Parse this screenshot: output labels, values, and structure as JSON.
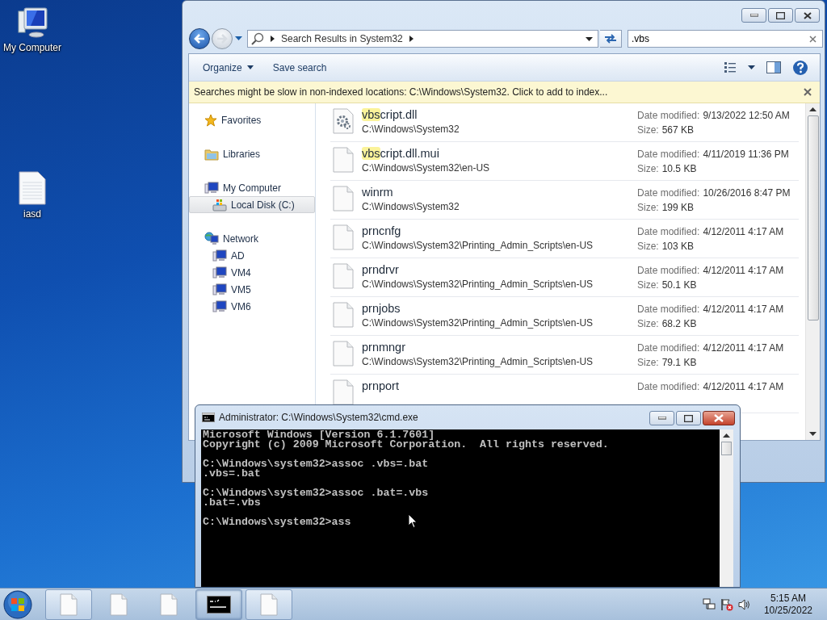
{
  "desktop_icons": [
    {
      "label": "My Computer",
      "kind": "computer"
    },
    {
      "label": "iasd",
      "kind": "text-file"
    }
  ],
  "explorer": {
    "address": {
      "crumb": "Search Results in System32"
    },
    "search": {
      "value": ".vbs"
    },
    "toolbar": {
      "organize": "Organize",
      "save_search": "Save search"
    },
    "info_bar": "Searches might be slow in non-indexed locations: C:\\Windows\\System32. Click to add to index...",
    "nav_pane": [
      {
        "label": "Favorites",
        "kind": "star",
        "selected": false
      },
      {
        "label": "Libraries",
        "kind": "library",
        "selected": false
      },
      {
        "label": "My Computer",
        "kind": "computer",
        "selected": false,
        "children": [
          {
            "label": "Local Disk (C:)",
            "kind": "drive",
            "selected": true
          }
        ]
      },
      {
        "label": "Network",
        "kind": "network",
        "selected": false,
        "children": [
          {
            "label": "AD",
            "kind": "computer",
            "selected": false
          },
          {
            "label": "VM4",
            "kind": "computer",
            "selected": false
          },
          {
            "label": "VM5",
            "kind": "computer",
            "selected": false
          },
          {
            "label": "VM6",
            "kind": "computer",
            "selected": false
          }
        ]
      }
    ],
    "files": [
      {
        "kind": "settings-file",
        "name_parts": [
          {
            "text": "vbs",
            "highlighted": true
          },
          {
            "text": "cript.dll",
            "highlighted": false
          }
        ],
        "path": "C:\\Windows\\System32",
        "date_label": "Date modified:",
        "date": "9/13/2022 12:50 AM",
        "size_label": "Size:",
        "size": "567 KB"
      },
      {
        "kind": "file",
        "name_parts": [
          {
            "text": "vbs",
            "highlighted": true
          },
          {
            "text": "cript.dll.mui",
            "highlighted": false
          }
        ],
        "path": "C:\\Windows\\System32\\en-US",
        "date_label": "Date modified:",
        "date": "4/11/2019 11:36 PM",
        "size_label": "Size:",
        "size": "10.5 KB"
      },
      {
        "kind": "file",
        "name_parts": [
          {
            "text": "winrm",
            "highlighted": false
          }
        ],
        "path": "C:\\Windows\\System32",
        "date_label": "Date modified:",
        "date": "10/26/2016 8:47 PM",
        "size_label": "Size:",
        "size": "199 KB"
      },
      {
        "kind": "file",
        "name_parts": [
          {
            "text": "prncnfg",
            "highlighted": false
          }
        ],
        "path": "C:\\Windows\\System32\\Printing_Admin_Scripts\\en-US",
        "date_label": "Date modified:",
        "date": "4/12/2011 4:17 AM",
        "size_label": "Size:",
        "size": "103 KB"
      },
      {
        "kind": "file",
        "name_parts": [
          {
            "text": "prndrvr",
            "highlighted": false
          }
        ],
        "path": "C:\\Windows\\System32\\Printing_Admin_Scripts\\en-US",
        "date_label": "Date modified:",
        "date": "4/12/2011 4:17 AM",
        "size_label": "Size:",
        "size": "50.1 KB"
      },
      {
        "kind": "file",
        "name_parts": [
          {
            "text": "prnjobs",
            "highlighted": false
          }
        ],
        "path": "C:\\Windows\\System32\\Printing_Admin_Scripts\\en-US",
        "date_label": "Date modified:",
        "date": "4/12/2011 4:17 AM",
        "size_label": "Size:",
        "size": "68.2 KB"
      },
      {
        "kind": "file",
        "name_parts": [
          {
            "text": "prnmngr",
            "highlighted": false
          }
        ],
        "path": "C:\\Windows\\System32\\Printing_Admin_Scripts\\en-US",
        "date_label": "Date modified:",
        "date": "4/12/2011 4:17 AM",
        "size_label": "Size:",
        "size": "79.1 KB"
      },
      {
        "kind": "file",
        "name_parts": [
          {
            "text": "prnport",
            "highlighted": false
          }
        ],
        "date_label": "Date modified:",
        "date": "4/12/2011 4:17 AM"
      }
    ]
  },
  "console": {
    "title": "Administrator: C:\\Windows\\System32\\cmd.exe",
    "blocks": [
      [
        "Microsoft Windows [Version 6.1.7601]",
        "Copyright (c) 2009 Microsoft Corporation.  All rights reserved."
      ],
      [
        "C:\\Windows\\system32>assoc .vbs=.bat",
        ".vbs=.bat"
      ],
      [
        "C:\\Windows\\system32>assoc .bat=.vbs",
        ".bat=.vbs"
      ],
      [
        "C:\\Windows\\system32>ass"
      ]
    ]
  },
  "taskbar": {
    "buttons": [
      {
        "kind": "document",
        "open": true,
        "selected": false
      },
      {
        "kind": "document",
        "open": false,
        "selected": false
      },
      {
        "kind": "document",
        "open": false,
        "selected": false
      },
      {
        "kind": "console",
        "open": true,
        "selected": true
      },
      {
        "kind": "document",
        "open": true,
        "selected": false
      }
    ],
    "clock": {
      "time": "5:15 AM",
      "date": "10/25/2022"
    }
  }
}
